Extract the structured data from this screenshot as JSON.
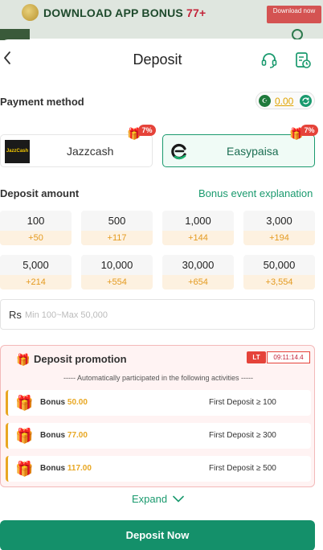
{
  "banner": {
    "text": "DOWNLOAD APP BONUS ",
    "highlight": "77+",
    "download_label": "Download now"
  },
  "header": {
    "title": "Deposit"
  },
  "payment": {
    "label": "Payment method",
    "balance": "0.00",
    "methods": [
      {
        "name": "Jazzcash",
        "logo_text": "JazzCash",
        "bonus": "7%",
        "selected": false
      },
      {
        "name": "Easypaisa",
        "bonus": "7%",
        "selected": true
      }
    ]
  },
  "deposit": {
    "label": "Deposit amount",
    "bonus_link": "Bonus event explanation",
    "amounts": [
      {
        "amount": "100",
        "bonus": "+50"
      },
      {
        "amount": "500",
        "bonus": "+117"
      },
      {
        "amount": "1,000",
        "bonus": "+144"
      },
      {
        "amount": "3,000",
        "bonus": "+194"
      },
      {
        "amount": "5,000",
        "bonus": "+214"
      },
      {
        "amount": "10,000",
        "bonus": "+554"
      },
      {
        "amount": "30,000",
        "bonus": "+654"
      },
      {
        "amount": "50,000",
        "bonus": "+3,554"
      }
    ],
    "currency": "Rs",
    "placeholder": "Min 100~Max 50,000",
    "value": ""
  },
  "promotion": {
    "title": "Deposit promotion",
    "lt_label": "LT",
    "countdown": "09:11:14.4",
    "subtitle": "----- Automatically participated in the following activities -----",
    "items": [
      {
        "label": "Bonus ",
        "amount": "50.00",
        "condition": "First Deposit ≥ 100"
      },
      {
        "label": "Bonus ",
        "amount": "77.00",
        "condition": "First Deposit ≥ 300"
      },
      {
        "label": "Bonus ",
        "amount": "117.00",
        "condition": "First Deposit ≥ 500"
      }
    ],
    "expand_label": "Expand"
  },
  "action": {
    "deposit_label": "Deposit Now"
  },
  "colors": {
    "accent": "#14906a",
    "bonus": "#e49a1f",
    "badge": "#e5433a"
  }
}
